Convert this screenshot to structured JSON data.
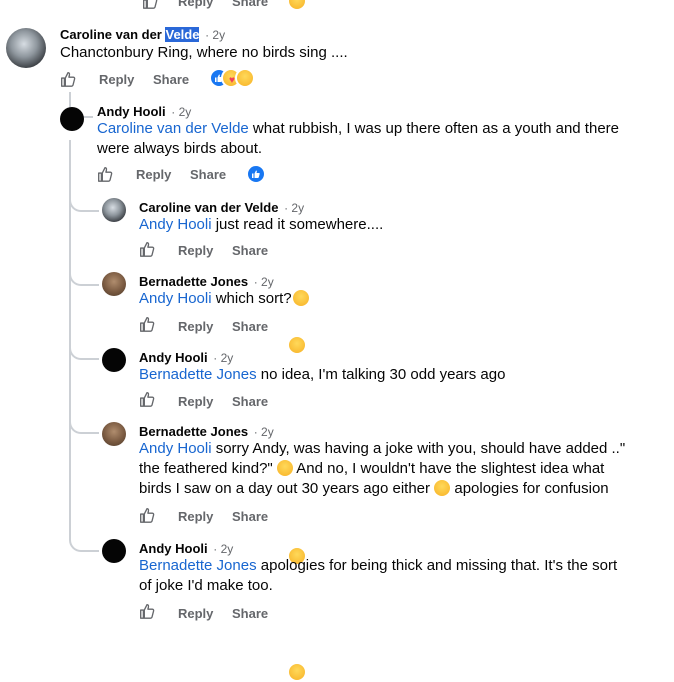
{
  "actions": {
    "reply": "Reply",
    "share": "Share"
  },
  "top_stub": {
    "reply": "Reply",
    "share": "Share"
  },
  "comments": [
    {
      "author_pre": "Caroline van der ",
      "author_hl": "Velde",
      "time": "· 2y",
      "text": "Chanctonbury Ring, where no birds sing ...."
    },
    {
      "author": "Andy Hooli",
      "time": "· 2y",
      "mention": "Caroline van der Velde",
      "text_a": " what rubbish, I was up there often as a youth and there",
      "text_b": "were always birds about."
    },
    {
      "author": "Caroline van der Velde",
      "time": "· 2y",
      "mention": "Andy Hooli",
      "text": " just read it somewhere...."
    },
    {
      "author": "Bernadette Jones",
      "time": "· 2y",
      "mention": "Andy Hooli",
      "text": " which sort?"
    },
    {
      "author": "Andy Hooli",
      "time": "· 2y",
      "mention": "Bernadette Jones",
      "text": " no idea, I'm talking 30 odd years ago"
    },
    {
      "author": "Bernadette Jones",
      "time": "· 2y",
      "mention": "Andy Hooli",
      "text_a": " sorry Andy, was having a joke with you, should have added ..\"",
      "text_b1": "the feathered kind?\" ",
      "text_b2": " And no, I wouldn't have the slightest idea what",
      "text_c1": "birds I saw on a day out 30 years ago either ",
      "text_c2": " apologies for confusion"
    },
    {
      "author": "Andy Hooli",
      "time": "· 2y",
      "mention": "Bernadette Jones",
      "text_a": " apologies for being thick and missing that. It's the sort",
      "text_b": "of joke I'd make too."
    }
  ]
}
